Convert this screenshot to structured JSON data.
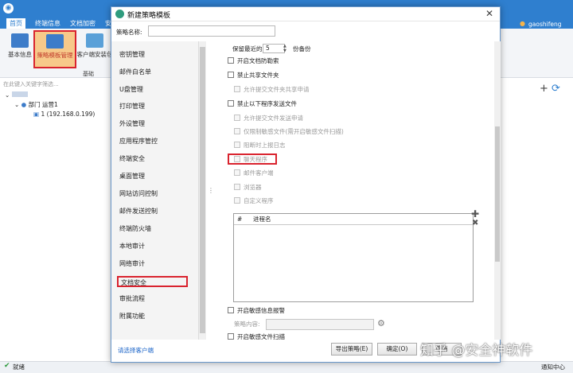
{
  "app": {
    "tabs": [
      "首页",
      "终端信息",
      "文档加密",
      "安"
    ],
    "user": "gaoshifeng",
    "ribbon": {
      "buttons": [
        "基本信息",
        "策略模板管理",
        "客户端安装包"
      ],
      "group_label": "基础"
    },
    "search_placeholder": "在此键入关键字筛选...",
    "tree": {
      "root": "",
      "dept": "部门 运营1",
      "device": "1 (192.168.0.199)"
    },
    "status_left": "就绪",
    "status_right": "通知中心"
  },
  "dialog": {
    "title": "新建策略模板",
    "name_label": "策略名称:",
    "name_value": "",
    "nav_items": [
      "密钥管理",
      "邮件白名单",
      "U盘管理",
      "打印管理",
      "外设管理",
      "应用程序管控",
      "终端安全",
      "桌面管理",
      "网站访问控制",
      "邮件发送控制",
      "终端防火墙",
      "本地审计",
      "网络审计",
      "文档安全",
      "审批流程",
      "附属功能"
    ],
    "active_nav": "文档安全",
    "content": {
      "backup_prefix": "保留最近的",
      "backup_value": "5",
      "backup_suffix": "份备份",
      "open_anti_leak": "开启文档防勒索",
      "disable_share": "禁止共享文件夹",
      "allow_share_apply": "允许提交文件夹共享申请",
      "forbid_send": "禁止以下程序发送文件",
      "allow_send_apply": "允许提交文件发送申请",
      "only_restrict_sensitive": "仅限制敏感文件(需开启敏感文件扫描)",
      "block_report": "阻断时上报日志",
      "chat_program": "聊天程序",
      "mail_client": "邮件客户端",
      "browser": "浏览器",
      "custom_program": "自定义程序",
      "table_col_hash": "#",
      "table_col_process": "进程名",
      "open_sensitive_report": "开启敏感信息报警",
      "strategy_content_label": "策略内容:",
      "open_sensitive_scan": "开启敏感文件扫描"
    },
    "footer_link": "请选择客户端",
    "buttons": {
      "export": "导出策略(E)",
      "ok": "确定(O)",
      "cancel": "取消"
    }
  },
  "watermark": "知乎 @安全神软件",
  "colors": {
    "titlebar": "#2f7fcf",
    "highlight": "#d9232e",
    "link": "#1b64c8"
  }
}
